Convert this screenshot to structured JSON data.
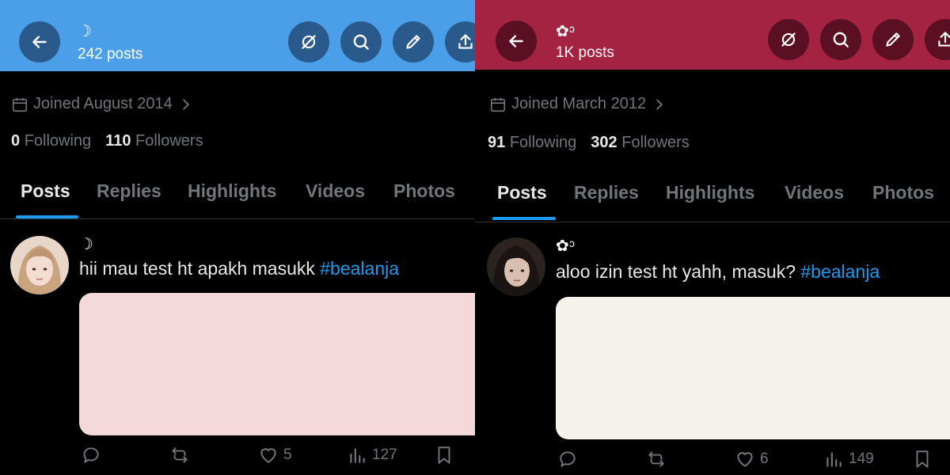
{
  "left": {
    "theme": {
      "header_color": "#4a9fe8",
      "button_color": "#2a5a8c",
      "media_color": "#f4d9d9"
    },
    "header": {
      "name": "☽",
      "posts": "242 posts"
    },
    "joined": "Joined August 2014",
    "following": {
      "count": "0",
      "label": "Following"
    },
    "followers": {
      "count": "110",
      "label": "Followers"
    },
    "tabs": [
      "Posts",
      "Replies",
      "Highlights",
      "Videos",
      "Photos"
    ],
    "post": {
      "author": "☽",
      "text": "hii mau test ht apakh masukk ",
      "hashtag": "#bealanja",
      "likes": "5",
      "views": "127"
    }
  },
  "right": {
    "theme": {
      "header_color": "#a42342",
      "button_color": "#5a0f22",
      "media_color": "#f5f2ec"
    },
    "header": {
      "name": "✿ᵓ",
      "posts": "1K posts"
    },
    "joined": "Joined March 2012",
    "following": {
      "count": "91",
      "label": "Following"
    },
    "followers": {
      "count": "302",
      "label": "Followers"
    },
    "tabs": [
      "Posts",
      "Replies",
      "Highlights",
      "Videos",
      "Photos"
    ],
    "post": {
      "author": "✿ᵓ",
      "text": "aloo izin test ht yahh, masuk? ",
      "hashtag": "#bealanja",
      "likes": "6",
      "views": "149"
    }
  },
  "colors": {
    "accent": "#1d9bf0",
    "muted": "#71767b",
    "text": "#e7e9ea"
  }
}
